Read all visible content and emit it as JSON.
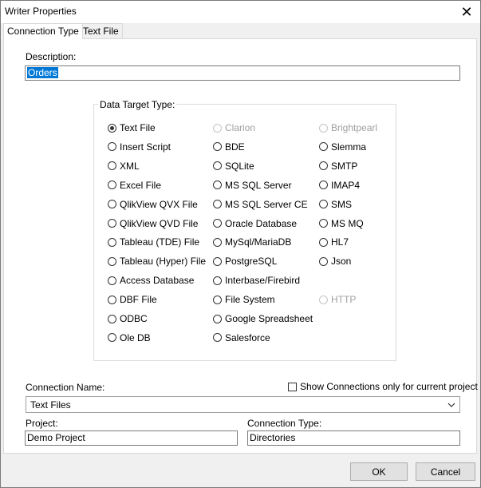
{
  "window": {
    "title": "Writer Properties"
  },
  "tabs": [
    {
      "label": "Connection Type"
    },
    {
      "label": "Text File"
    }
  ],
  "description": {
    "label": "Description:",
    "value": "Orders"
  },
  "data_target": {
    "title": "Data Target Type:",
    "col1": [
      "Text File",
      "Insert Script",
      "XML",
      "Excel File",
      "QlikView QVX File",
      "QlikView QVD File",
      "Tableau (TDE) File",
      "Tableau (Hyper) File",
      "Access Database",
      "DBF File",
      "ODBC",
      "Ole DB"
    ],
    "col2": [
      "Clarion",
      "BDE",
      "SQLite",
      "MS SQL Server",
      "MS SQL Server CE",
      "Oracle Database",
      "MySql/MariaDB",
      "PostgreSQL",
      "Interbase/Firebird",
      "File System",
      "Google Spreadsheet",
      "Salesforce"
    ],
    "col3": [
      "Brightpearl",
      "Slemma",
      "SMTP",
      "IMAP4",
      "SMS",
      "MS MQ",
      "HL7",
      "Json",
      "HTTP"
    ],
    "selected": "Text File"
  },
  "connection": {
    "name_label": "Connection Name:",
    "show_only_label": "Show Connections only for current project",
    "name_value": "Text Files",
    "project_label": "Project:",
    "project_value": "Demo Project",
    "type_label": "Connection Type:",
    "type_value": "Directories"
  },
  "buttons": {
    "ok": "OK",
    "cancel": "Cancel"
  }
}
